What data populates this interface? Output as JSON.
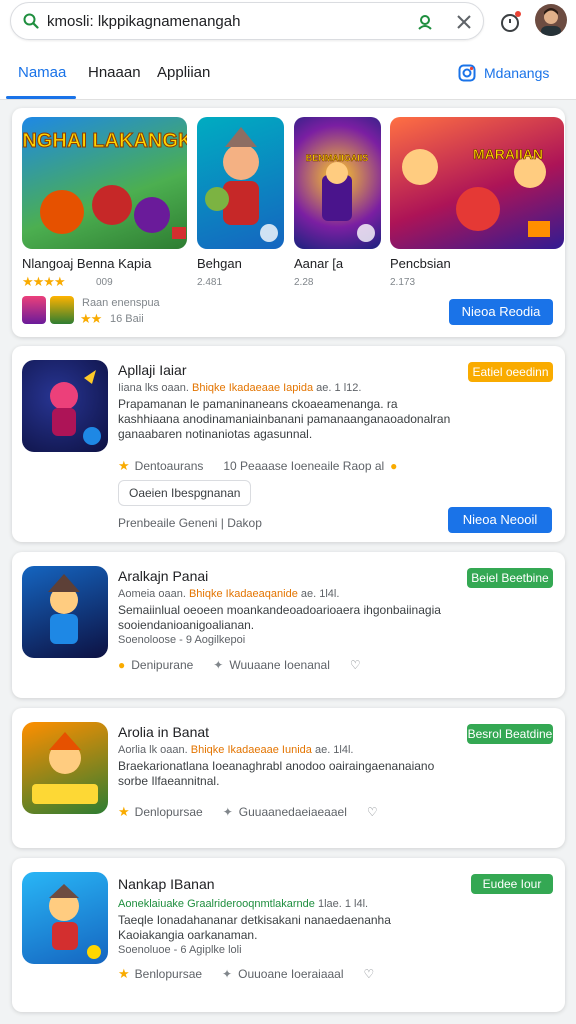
{
  "colors": {
    "accent": "#1a73e8",
    "orange": "#f9ab00",
    "green": "#34a853",
    "star": "#f9ab00"
  },
  "search": {
    "query": "kmosli: lkppikagnamenangah",
    "icon": "search-icon"
  },
  "tabs": [
    {
      "label": "Namaa"
    },
    {
      "label": "Hnaaan"
    },
    {
      "label": "Appliian"
    }
  ],
  "tabs_right": {
    "label": "Mdanangs",
    "icon": "instagram-like-icon"
  },
  "featured": {
    "items": [
      {
        "title": "LANGHAI LAKANGKAI",
        "name": "Nlangoaj  Benna Kapia",
        "rating": "★★★★",
        "sub": "009"
      },
      {
        "name": "Behgan",
        "sub": "2.481"
      },
      {
        "title": "BENMAIIGAIIS",
        "name": "Aanar [a",
        "sub": "2.28"
      },
      {
        "title": "MARAIIAN",
        "name": "Pencbsian",
        "sub": "2.173"
      }
    ],
    "extra_line": "Raan enenspua",
    "extra_rating": "★★",
    "extra_sub": "16 Baii",
    "button": "Nieoa  Reodia"
  },
  "apps": [
    {
      "title": "Apllaji Iaiar",
      "meta_a": "Iiana lks oaan.",
      "meta_hl": "Bhiqke Ikadaeaae Iapida",
      "meta_b": "ae. 1 l12.",
      "desc": "Prapamanan le pamaninaneans ckoaeamenanga. ra kashhiaana anodinamaniainbanani pamanaanganaoadonalran ganaabaren notinaniotas agasunnal.",
      "row1_a": "Dentoaurans",
      "row1_b": "10 Peaaase Ioeneaile Raop al",
      "outline": "Oaeien Ibespgnanan",
      "row2": "Prenbeaile Geneni | Dakop",
      "pill": "Eatiel oeedinn",
      "button": "Nieoa  Neooil"
    },
    {
      "title": "Aralkajn Panai",
      "meta_a": "Aomeia oaan.",
      "meta_hl": "Bhiqke Ikadaeaqanide",
      "meta_b": "ae. 1l4l.",
      "desc": "Semaiinlual oeoeen moankandeoadoarioaera ihgonbaiinagia sooiendanioanigoalianan.",
      "sub": "Soenoloose - 9 Aogilkepoi",
      "row1_a": "Denipurane",
      "row1_b": "Wuuaane Ioenanal",
      "pill": "Beiel Beetbine"
    },
    {
      "title": "Arolia in Banat",
      "meta_a": "Aorlia lk oaan.",
      "meta_hl": "Bhiqke Ikadaeaae Iunida",
      "meta_b": "ae. 1l4l.",
      "desc": "Braekarionatlana Ioeanaghrabl anodoo oairaingaenanaiano sorbe Ilfaeannitnal.",
      "row1_a": "Denlopursae",
      "row1_b": "Guuaanedaeiaeaael",
      "pill": "Besrol Beatdine"
    },
    {
      "title": "Nankap IBanan",
      "meta_a": "",
      "meta_hl": "Aoneklaiuake Graalriderooqnmtlakarnde",
      "meta_b": "1lae. 1 l4l.",
      "desc": "Taeqle Ionadahananar detkisakani nanaedaenanha Kaoiakangia oarkanaman.",
      "sub": "Soenoluoe - 6 Agiplke loli",
      "row1_a": "Benlopursae",
      "row1_b": "Ouuoane Ioeraiaaal",
      "pill": "Eudee Iour"
    }
  ]
}
